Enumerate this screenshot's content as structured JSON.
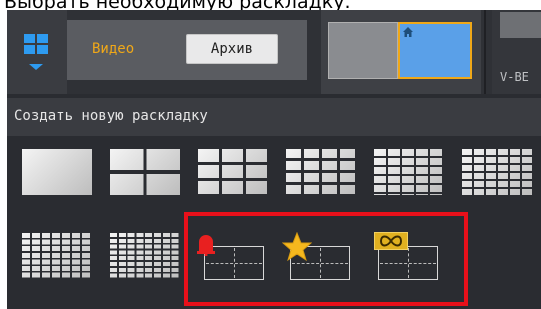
{
  "caption": "Выбрать необходимую раскладку.",
  "toolbar": {
    "video_label": "Видео",
    "archive_label": "Архив",
    "camera_label": "V-BE"
  },
  "layout_panel": {
    "create_label": "Создать новую раскладку",
    "preset_layouts": [
      "1x1",
      "2x2",
      "3x3",
      "4x4",
      "5x5",
      "6x6",
      "7x7",
      "8x8"
    ],
    "special_layouts": [
      "alarm",
      "favorites",
      "infinite"
    ]
  },
  "icons": {
    "layout_menu": "layout-grid-icon",
    "dropdown": "chevron-down-icon",
    "home": "home-icon",
    "alarm": "alarm-bell-icon",
    "favorites": "star-icon",
    "infinite": "infinity-icon"
  },
  "colors": {
    "accent_blue": "#2e9bf0",
    "accent_orange": "#f0a818",
    "highlight_red": "#e8101a",
    "alarm_red": "#e82020",
    "star_yellow": "#f5b81e"
  }
}
